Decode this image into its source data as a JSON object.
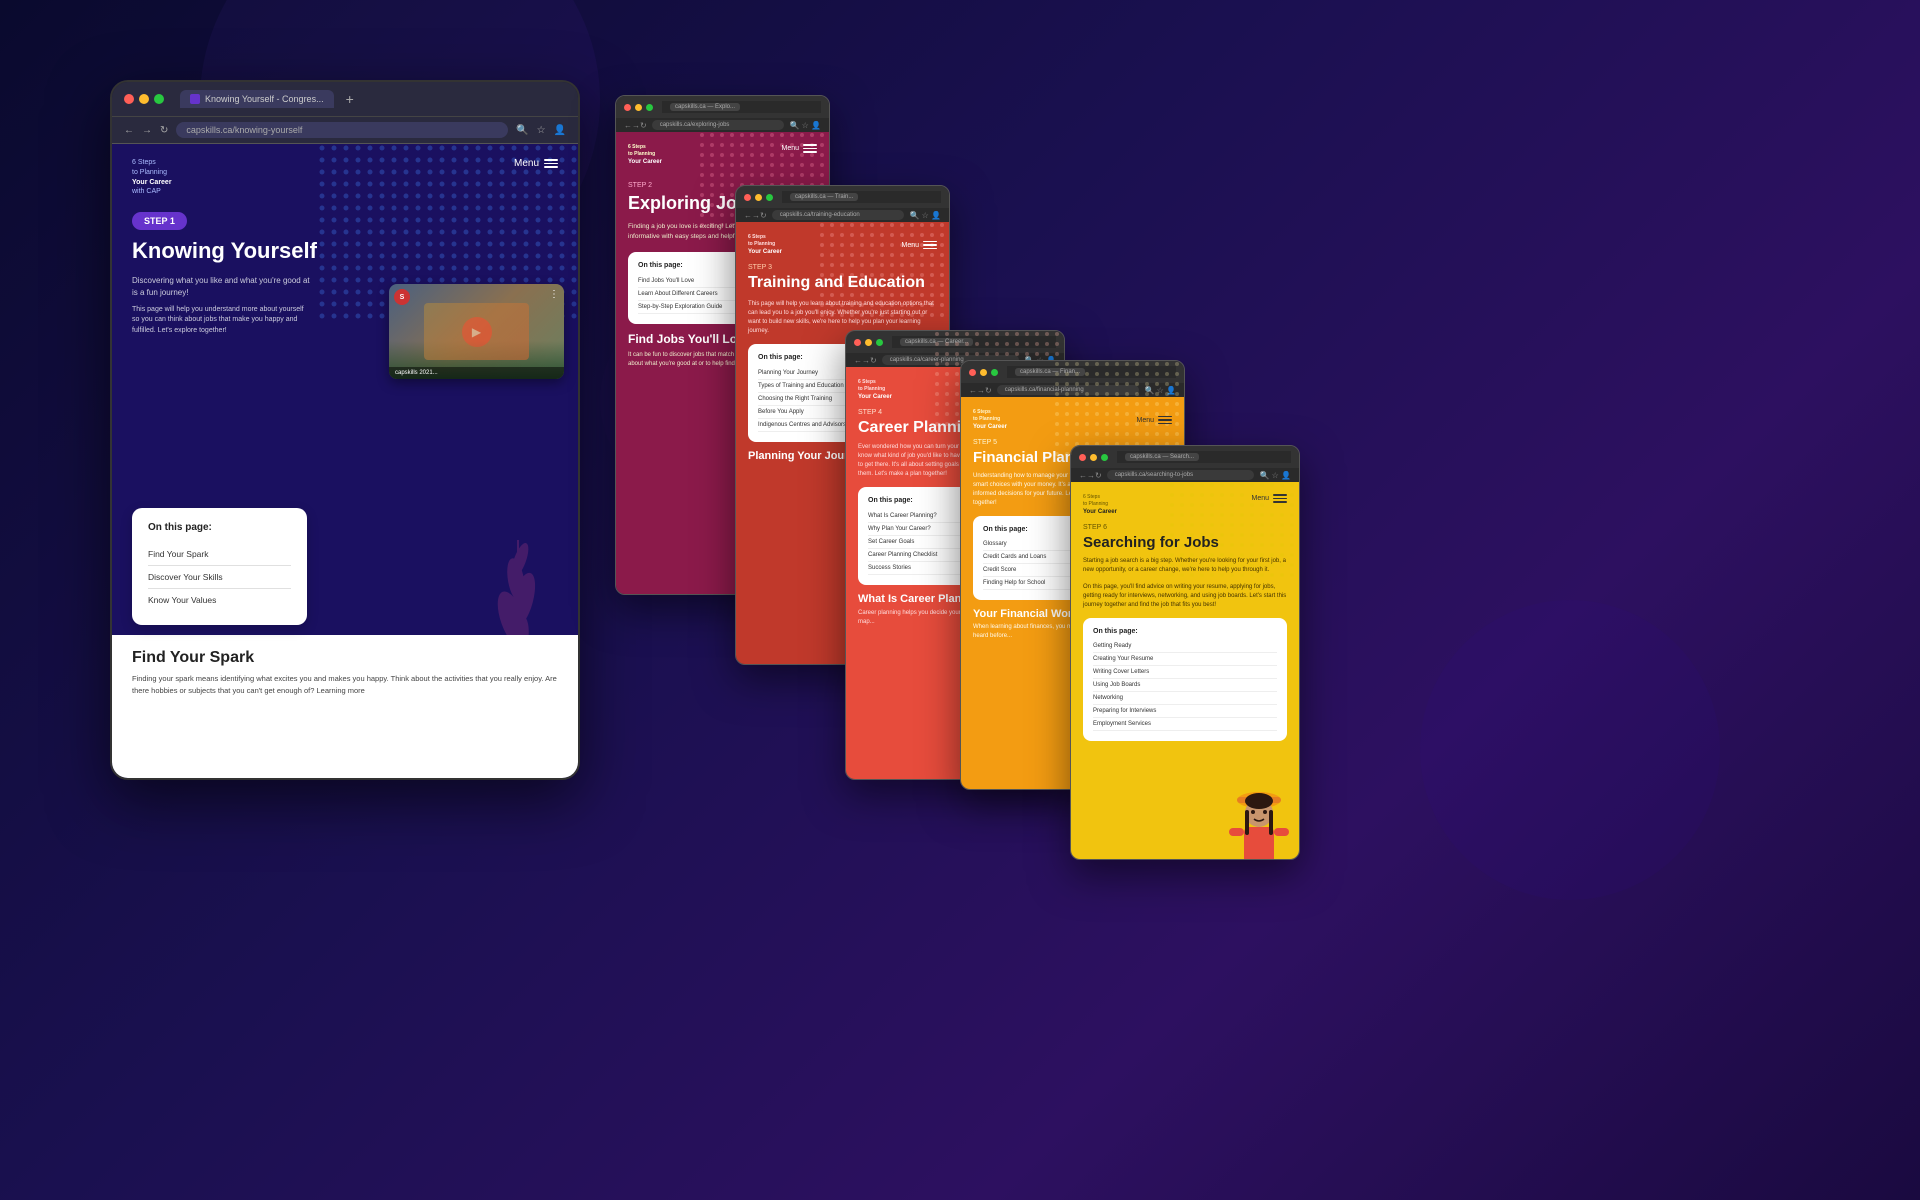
{
  "background": {
    "color": "#0a0a2e"
  },
  "mainBrowser": {
    "tab": "Knowing Yourself - Congres...",
    "address": "capskills.ca/knowing-yourself",
    "logo": "6 Steps\nto Planning\nYour Career\nwith CAP",
    "menu": "Menu",
    "stepBadge": "STEP 1",
    "pageTitle": "Knowing Yourself",
    "intro1": "Discovering what you like and what you're good at is a fun journey!",
    "intro2": "This page will help you understand more about yourself so you can think about jobs that make you happy and fulfilled. Let's explore together!",
    "video": {
      "userInitial": "S",
      "title": "capskills 2021..."
    },
    "onPage": {
      "title": "On this page:",
      "links": [
        "Find Your Spark",
        "Discover Your Skills",
        "Know Your Values"
      ]
    },
    "bottomSection": {
      "heading": "Find Your Spark",
      "text": "Finding your spark means identifying what excites you and makes you happy. Think about the activities that you really enjoy. Are there hobbies or subjects that you can't get enough of? Learning more"
    }
  },
  "window1": {
    "step": "STEP 2",
    "title": "Exploring Jobs",
    "logo": "6 Steps\nto Planning\nYour Career",
    "menu": "Menu",
    "desc": "Finding a job you love is exciting! Let's make this journey fun and informative with easy steps and helpful tips.",
    "onPage": {
      "title": "On this page:",
      "links": [
        "Find Jobs You'll Love",
        "Learn About Different Careers",
        "Step-by-Step Exploration Guide"
      ]
    },
    "findTitle": "Find Jobs You'll Love",
    "findText": "It can be fun to discover jobs that match your interests and skills. Think about what you're good at or to help find job ide..."
  },
  "window2": {
    "step": "STEP 3",
    "title": "Training and Education",
    "logo": "6 Steps\nto Planning\nYour Career",
    "menu": "Menu",
    "desc": "This page will help you learn about training and education options that can lead you to a job you'll enjoy. Whether you're just starting out or want to build new skills, we're here to help you plan your learning journey.",
    "onPage": {
      "title": "On this page:",
      "links": [
        "Planning Your Journey",
        "Types of Training and Education",
        "Choosing the Right Training",
        "Before You Apply",
        "Indigenous Centres and Advisors"
      ]
    },
    "planTitle": "Planning Your Journey"
  },
  "window3": {
    "step": "STEP 4",
    "title": "Career Planning",
    "logo": "6 Steps\nto Planning\nYour Career",
    "menu": "Menu",
    "desc": "Ever wondered how you can turn your dreams into a plan? Once you know what kind of job you'd like to have, you can start planning out how to get there. It's all about setting goals and figuring out the steps to reach them. Let's make a plan together!",
    "onPage": {
      "title": "On this page:",
      "links": [
        "What Is Career Planning?",
        "Why Plan Your Career?",
        "Set Career Goals",
        "Career Planning Checklist",
        "Success Stories"
      ]
    },
    "careerTitle": "What Is Career Planning?",
    "careerText": "Career planning helps you decide your future path. It's like drawing a map..."
  },
  "window4": {
    "step": "STEP 5",
    "title": "Financial Planning",
    "logo": "6 Steps\nto Planning\nYour Career",
    "menu": "Menu",
    "desc": "Understanding how to manage your finances is the first step to making smart choices with your money. It's about learning the basics and making informed decisions for your future. Let's explore financial planning together!",
    "onPage": {
      "title": "On this page:",
      "links": [
        "Glossary",
        "Credit Cards and Loans",
        "Credit Score",
        "Finding Help for School"
      ]
    },
    "wordsTitle": "Your Financial Words Glo...",
    "wordsText": "When learning about finances, you may come across words you haven't heard before..."
  },
  "window5": {
    "step": "STEP 6",
    "title": "Searching for Jobs",
    "logo": "6 Steps\nto Planning\nYour Career",
    "menu": "Menu",
    "desc": "Starting a job search is a big step. Whether you're looking for your first job, a new opportunity, or a career change, we're here to help you through it.",
    "onPageDesc": "On this page, you'll find advice on writing your resume, applying for jobs, getting ready for interviews, networking, and using job boards. Let's start this journey together and find the job that fits you best!",
    "onPage": {
      "title": "On this page:",
      "links": [
        "Getting Ready",
        "Creating Your Resume",
        "Writing Cover Letters",
        "Using Job Boards",
        "Networking",
        "Preparing for Interviews",
        "Employment Services"
      ]
    }
  }
}
